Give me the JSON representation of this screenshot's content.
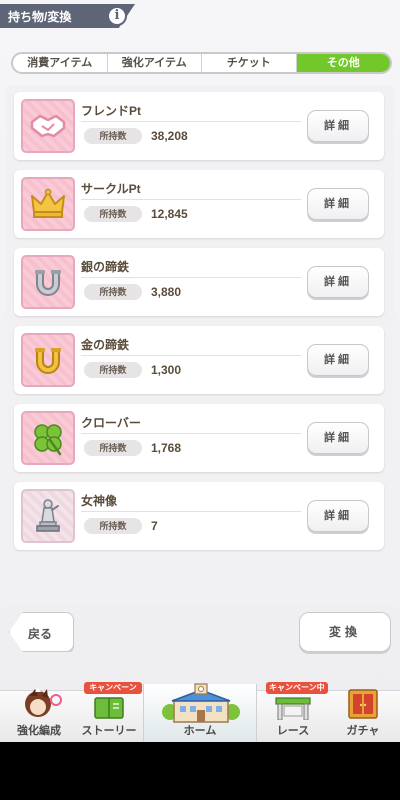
{
  "header": {
    "title": "持ち物/変換",
    "info_label": "i"
  },
  "tabs": [
    {
      "label": "消費アイテム",
      "active": false
    },
    {
      "label": "強化アイテム",
      "active": false
    },
    {
      "label": "チケット",
      "active": false
    },
    {
      "label": "その他",
      "active": true
    }
  ],
  "items": [
    {
      "name": "フレンドPt",
      "count_label": "所持数",
      "count": "38,208",
      "button": "詳細",
      "icon": "handshake-icon"
    },
    {
      "name": "サークルPt",
      "count_label": "所持数",
      "count": "12,845",
      "button": "詳細",
      "icon": "crown-icon"
    },
    {
      "name": "銀の蹄鉄",
      "count_label": "所持数",
      "count": "3,880",
      "button": "詳細",
      "icon": "silver-horseshoe-icon"
    },
    {
      "name": "金の蹄鉄",
      "count_label": "所持数",
      "count": "1,300",
      "button": "詳細",
      "icon": "gold-horseshoe-icon"
    },
    {
      "name": "クローバー",
      "count_label": "所持数",
      "count": "1,768",
      "button": "詳細",
      "icon": "clover-icon"
    },
    {
      "name": "女神像",
      "count_label": "所持数",
      "count": "7",
      "button": "詳細",
      "icon": "goddess-statue-icon"
    }
  ],
  "actions": {
    "back_label": "戻る",
    "convert_label": "変換"
  },
  "nav": {
    "enhance_label": "強化編成",
    "story_label": "ストーリー",
    "home_label": "ホーム",
    "race_label": "レース",
    "gacha_label": "ガチャ",
    "campaign_badge": "キャンペーン中"
  },
  "colors": {
    "active_tab": "#72c82a",
    "header_bar": "#5d6577",
    "icon_bg": "#f9cbd7",
    "campaign_badge": "#e8513e"
  }
}
